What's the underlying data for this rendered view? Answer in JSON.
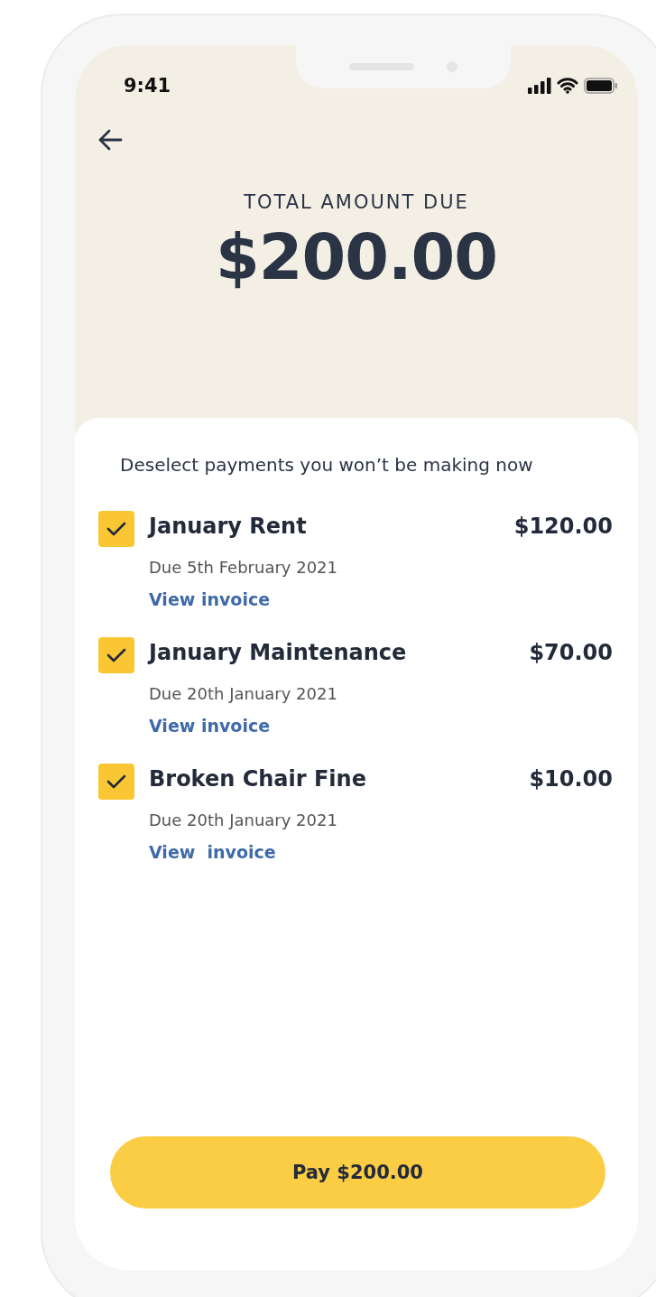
{
  "status_bar": {
    "time": "9:41"
  },
  "header": {
    "label": "TOTAL AMOUNT DUE",
    "amount": "$200.00"
  },
  "instructions": "Deselect payments you won’t be making now",
  "payments": [
    {
      "title": "January Rent",
      "amount": "$120.00",
      "due": "Due 5th February 2021",
      "link": "View invoice",
      "checked": true
    },
    {
      "title": "January Maintenance",
      "amount": "$70.00",
      "due": "Due 20th January 2021",
      "link": "View invoice",
      "checked": true
    },
    {
      "title": "Broken Chair Fine",
      "amount": "$10.00",
      "due": "Due 20th January 2021",
      "link": "View  invoice",
      "checked": true
    }
  ],
  "pay_button": "Pay $200.00"
}
